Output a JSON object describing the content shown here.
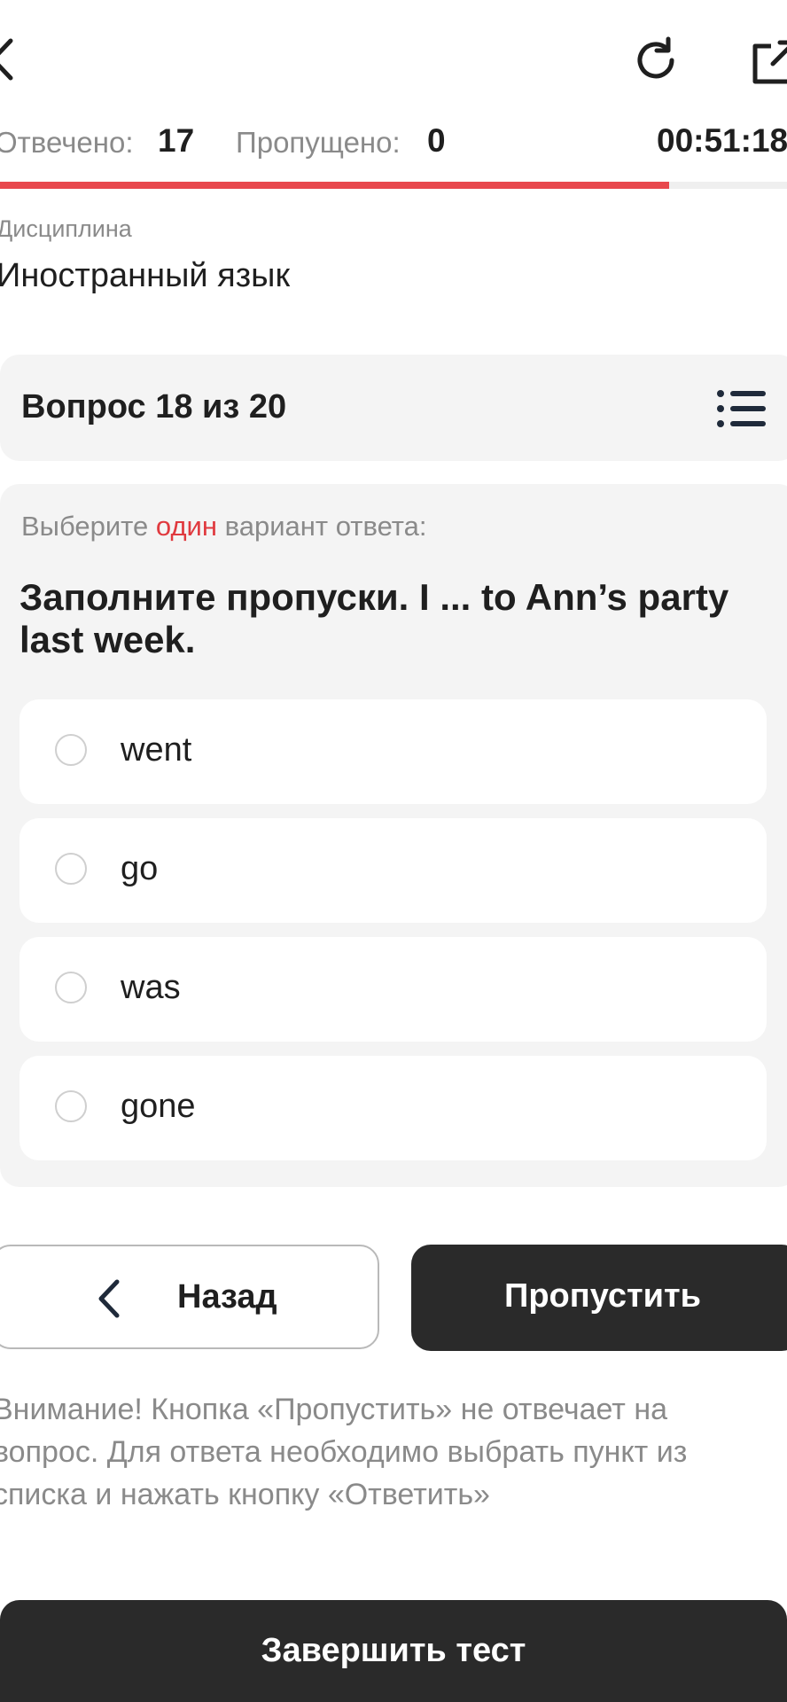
{
  "header": {
    "answered_label": "Отвечено:",
    "answered_value": "17",
    "skipped_label": "Пропущено:",
    "skipped_value": "0",
    "timer": "00:51:18",
    "progress_fraction": 0.85,
    "accent_color": "#e8484d",
    "icons": [
      "back-chevron-icon",
      "refresh-icon",
      "external-link-icon"
    ]
  },
  "discipline": {
    "caption": "Дисциплина",
    "name": "Иностранный язык"
  },
  "question": {
    "counter": "Вопрос 18 из 20",
    "instruction_before": "Выберите",
    "instruction_accent": "один",
    "instruction_after": "вариант ответа:",
    "text": "Заполните пропуски. I ... to Ann’s party last week.",
    "options": [
      {
        "label": "went"
      },
      {
        "label": "go"
      },
      {
        "label": "was"
      },
      {
        "label": "gone"
      }
    ]
  },
  "actions": {
    "back_label": "Назад",
    "skip_label": "Пропустить",
    "notice": "Внимание! Кнопка «Пропустить» не отвечает на вопрос. Для ответа необходимо выбрать пункт из списка и нажать кнопку «Ответить»",
    "finish_label": "Завершить тест"
  }
}
